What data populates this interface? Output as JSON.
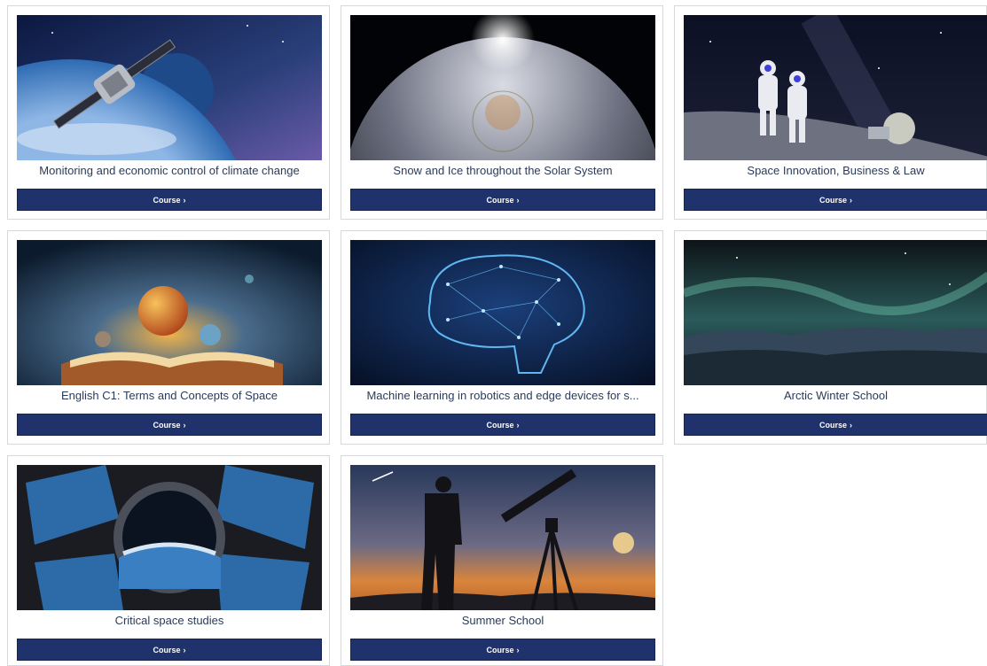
{
  "courses": [
    {
      "title": "Monitoring and economic control of climate change",
      "button": "Course",
      "image": "satellite-over-earth"
    },
    {
      "title": "Snow and Ice throughout the Solar System",
      "button": "Course",
      "image": "planet-horizon-sunrise"
    },
    {
      "title": "Space Innovation, Business & Law",
      "button": "Course",
      "image": "astronauts-on-moon"
    },
    {
      "title": "English C1: Terms and Concepts of Space",
      "button": "Course",
      "image": "planets-over-open-book"
    },
    {
      "title": "Machine learning in robotics and edge devices for s...",
      "button": "Course",
      "image": "network-brain"
    },
    {
      "title": "Arctic Winter School",
      "button": "Course",
      "image": "aurora-over-mountains"
    },
    {
      "title": "Critical space studies",
      "button": "Course",
      "image": "space-station-window"
    },
    {
      "title": "Summer School",
      "button": "Course",
      "image": "stargazer-with-telescope"
    }
  ],
  "colors": {
    "button_bg": "#1f326b",
    "title_text": "#2b3b57",
    "card_border": "#d8d8d8"
  },
  "icons": {
    "chevron": "chevron-right-icon"
  }
}
